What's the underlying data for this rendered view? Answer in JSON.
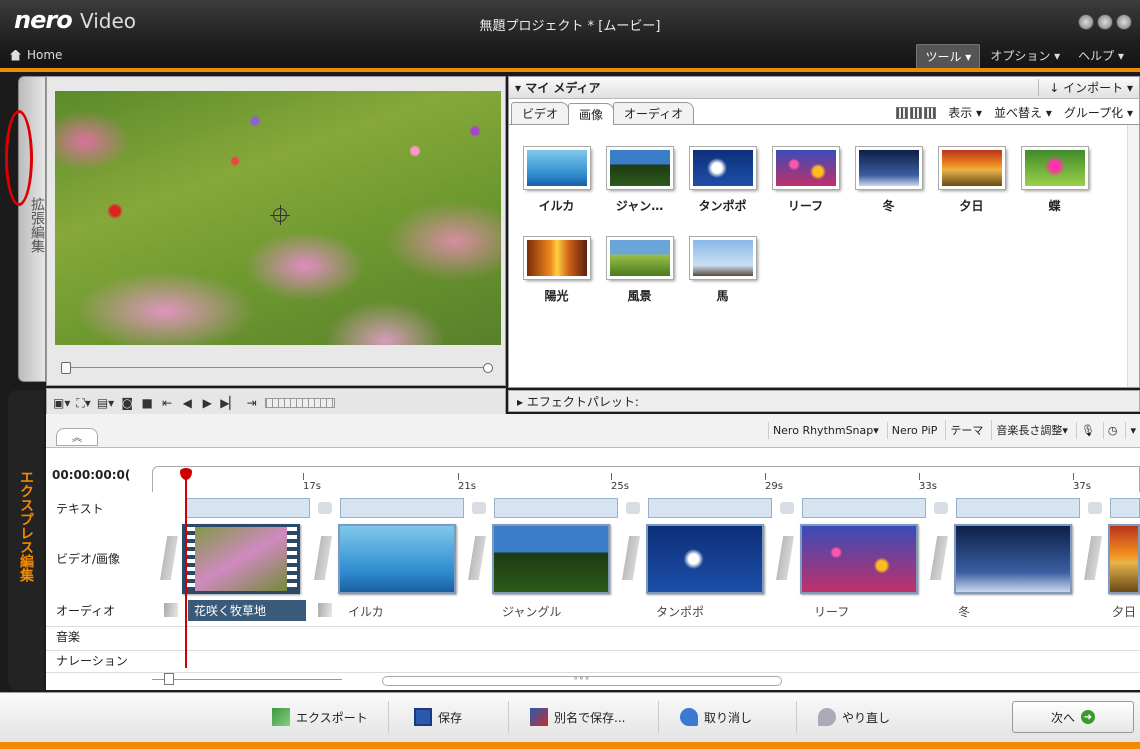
{
  "app": {
    "logo": "nero",
    "product": "Video",
    "window_title": "無題プロジェクト * [ムービー]",
    "home_label": "Home"
  },
  "menu": {
    "tools": "ツール ▾",
    "options": "オプション ▾",
    "help": "ヘルプ ▾"
  },
  "side_tabs": {
    "advanced": "拡張編集",
    "express": "エクスプレス編集"
  },
  "media": {
    "title": "▾ マイ メディア",
    "import": "↓ インポート ▾",
    "tabs": [
      "ビデオ",
      "画像",
      "オーディオ"
    ],
    "active_tab": "画像",
    "view": "表示 ▾",
    "sort": "並べ替え ▾",
    "group": "グループ化 ▾",
    "items": [
      {
        "label": "イルカ",
        "icon": "dolphin-thumbnail"
      },
      {
        "label": "ジャン…",
        "icon": "jungle-thumbnail"
      },
      {
        "label": "タンポポ",
        "icon": "dandelion-thumbnail"
      },
      {
        "label": "リーフ",
        "icon": "reef-thumbnail"
      },
      {
        "label": "冬",
        "icon": "winter-thumbnail"
      },
      {
        "label": "夕日",
        "icon": "sunset-thumbnail"
      },
      {
        "label": "蝶",
        "icon": "butterfly-thumbnail"
      },
      {
        "label": "陽光",
        "icon": "sunlight-thumbnail"
      },
      {
        "label": "風景",
        "icon": "landscape-thumbnail"
      },
      {
        "label": "馬",
        "icon": "horse-thumbnail"
      }
    ]
  },
  "effects": {
    "title": "▸ エフェクトパレット:"
  },
  "timeline_tools": {
    "rhythmsnap": "Nero RhythmSnap▾",
    "pip": "Nero PiP",
    "theme": "テーマ",
    "music_length": "音楽長さ調整▾"
  },
  "timeline": {
    "timecode": "00:00:00:0(",
    "ticks": [
      "17s",
      "21s",
      "25s",
      "29s",
      "33s",
      "37s"
    ],
    "tracks": [
      "テキスト",
      "ビデオ/画像",
      "オーディオ",
      "音楽",
      "ナレーション"
    ],
    "clips": [
      "花咲く牧草地",
      "イルカ",
      "ジャングル",
      "タンポポ",
      "リーフ",
      "冬",
      "夕日"
    ],
    "zoom_dots": "∘∘∘"
  },
  "bottom": {
    "export": "エクスポート",
    "save": "保存",
    "save_as": "別名で保存...",
    "undo": "取り消し",
    "redo": "やり直し",
    "next": "次へ"
  },
  "colors": {
    "accent_orange": "#f08a00",
    "selection_blue": "#2a4a6a",
    "highlight_red": "#dd0000"
  }
}
